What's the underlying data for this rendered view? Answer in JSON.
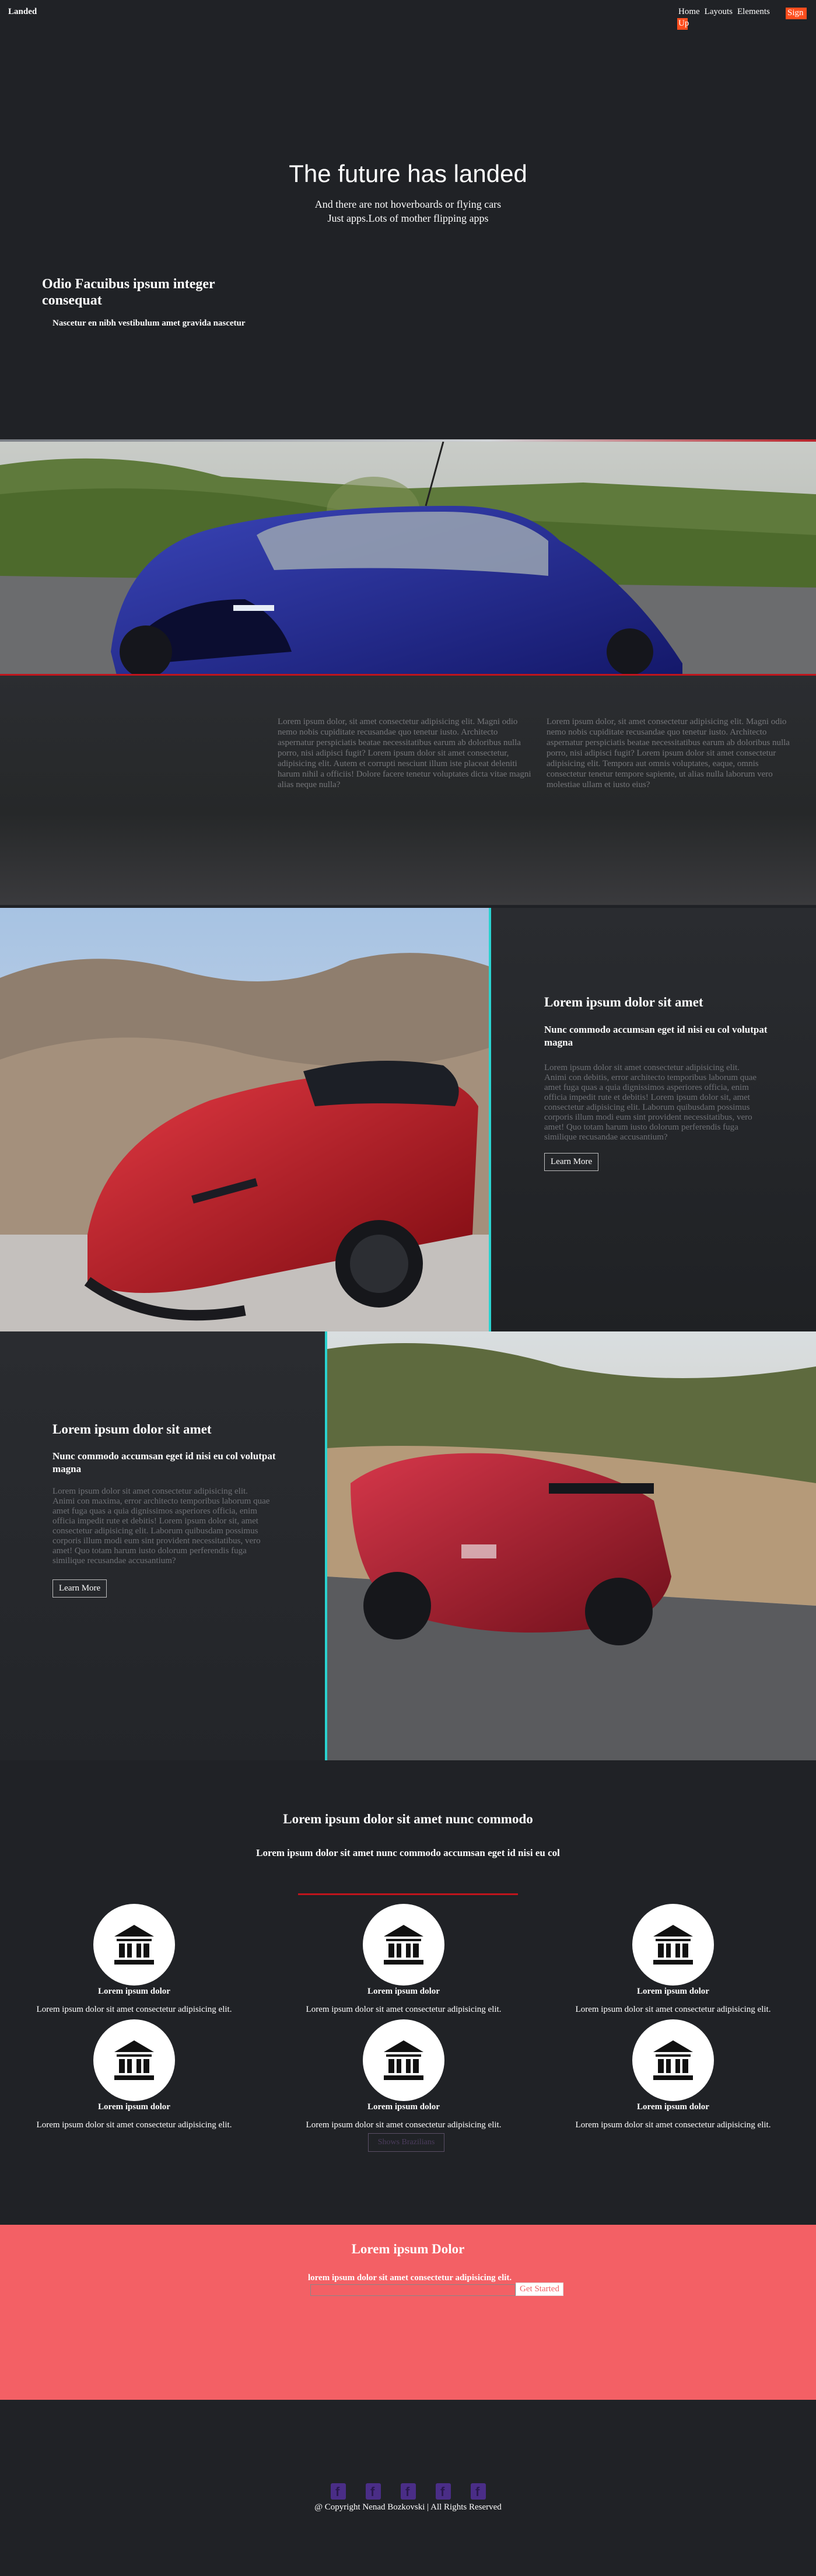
{
  "nav": {
    "brand": "Landed",
    "links": [
      "Home",
      "Layouts",
      "Elements"
    ],
    "signup_part1": "Sign",
    "signup_part2": "Up"
  },
  "hero": {
    "title": "The future has landed",
    "subtitle_line1": "And there are not hoverboards or flying cars",
    "subtitle_line2": "Just apps.Lots of mother flipping apps"
  },
  "section_one": {
    "heading": "Odio Facuibus ipsum integer consequat",
    "subheading": "Nascetur en nibh vestibulum amet gravida nascetur",
    "col1": "Lorem ipsum dolor, sit amet consectetur adipisicing elit. Magni odio nemo nobis cupiditate recusandae quo tenetur iusto. Architecto aspernatur perspiciatis beatae necessitatibus earum ab doloribus nulla porro, nisi adipisci fugit? Lorem ipsum dolor sit amet consectetur, adipisicing elit. Autem et corrupti nesciunt illum iste placeat deleniti harum nihil a officiis! Dolore facere tenetur voluptates dicta vitae magni alias neque nulla?",
    "col2": "Lorem ipsum dolor, sit amet consectetur adipisicing elit. Magni odio nemo nobis cupiditate recusandae quo tenetur iusto. Architecto aspernatur perspiciatis beatae necessitatibus earum ab doloribus nulla porro, nisi adipisci fugit? Lorem ipsum dolor sit amet consectetur adipisicing elit. Tempora aut omnis voluptates, eaque, omnis consectetur tenetur tempore sapiente, ut alias nulla laborum vero molestiae ullam et iusto eius?"
  },
  "feature_one": {
    "heading": "Lorem ipsum dolor sit amet",
    "subheading": "Nunc commodo accumsan eget id nisi eu col volutpat magna",
    "body": "Lorem ipsum dolor sit amet consectetur adipisicing elit. Animi con debitis, error architecto temporibus laborum quae amet fuga quas a quia dignissimos asperiores officia, enim officia impedit rute et debitis! Lorem ipsum dolor sit, amet consectetur adipisicing elit. Laborum quibusdam possimus corporis illum modi eum sint provident necessitatibus, vero amet! Quo totam harum iusto dolorum perferendis fuga similique recusandae accusantium?",
    "button": "Learn More"
  },
  "feature_two": {
    "heading": "Lorem ipsum dolor sit amet",
    "subheading": "Nunc commodo accumsan eget id nisi eu col volutpat magna",
    "body": "Lorem ipsum dolor sit amet consectetur adipisicing elit. Animi con maxima, error architecto temporibus laborum quae amet fuga quas a quia dignissimos asperiores officia, enim officia impedit rute et debitis! Lorem ipsum dolor sit, amet consectetur adipisicing elit. Laborum quibusdam possimus corporis illum modi eum sint provident necessitatibus, vero amet! Quo totam harum iusto dolorum perferendis fuga similique recusandae accusantium?",
    "button": "Learn More"
  },
  "features": {
    "title": "Lorem ipsum dolor sit amet nunc commodo",
    "subtitle": "Lorem ipsum dolor sit amet nunc commodo accumsan eget id nisi eu col",
    "cards": [
      {
        "title": "Lorem ipsum dolor",
        "desc": "Lorem ipsum dolor sit amet consectetur adipisicing elit."
      },
      {
        "title": "Lorem ipsum dolor",
        "desc": "Lorem ipsum dolor sit amet consectetur adipisicing elit."
      },
      {
        "title": "Lorem ipsum dolor",
        "desc": "Lorem ipsum dolor sit amet consectetur adipisicing elit."
      },
      {
        "title": "Lorem ipsum dolor",
        "desc": "Lorem ipsum dolor sit amet consectetur adipisicing elit."
      },
      {
        "title": "Lorem ipsum dolor",
        "desc": "Lorem ipsum dolor sit amet consectetur adipisicing elit."
      },
      {
        "title": "Lorem ipsum dolor",
        "desc": "Lorem ipsum dolor sit amet consectetur adipisicing elit."
      }
    ],
    "button": "Shows Brazilians",
    "icon": "bank-icon"
  },
  "signup": {
    "title": "Lorem ipsum Dolor",
    "label": "lorem ipsum dolor sit amet consectetur adipisicing elit.",
    "button": "Get Started",
    "input_value": ""
  },
  "footer": {
    "social_icons": [
      "facebook-icon",
      "facebook-icon",
      "facebook-icon",
      "facebook-icon",
      "facebook-icon"
    ],
    "copyright": "@ Copyright Nenad Bozkovski | All Rights Reserved"
  },
  "colors": {
    "background": "#202226",
    "accent_orange": "#ff4e1e",
    "accent_red": "#c0141c",
    "teal": "#2ad3d0",
    "signup_bg": "#f36065",
    "social_purple": "#4a2d87"
  }
}
